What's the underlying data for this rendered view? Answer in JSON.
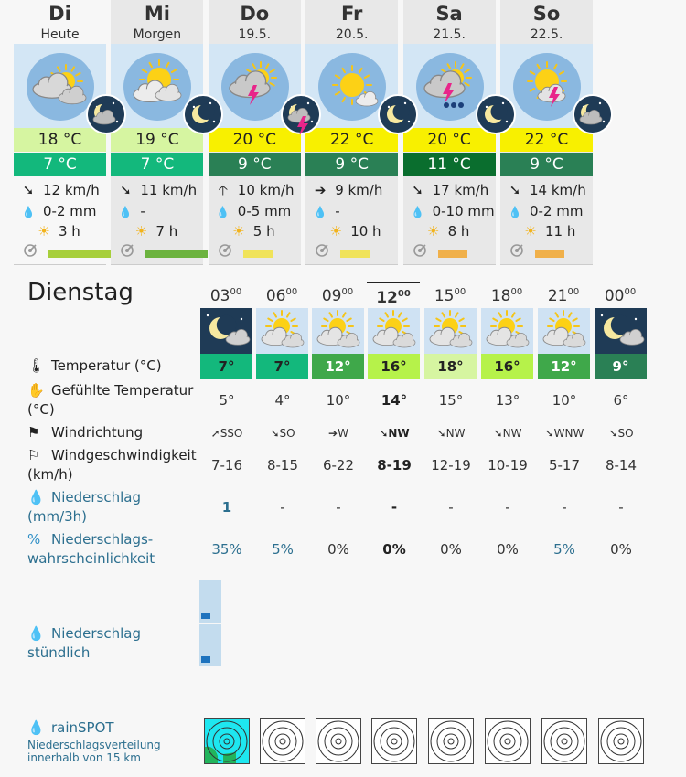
{
  "days": [
    {
      "name": "Di",
      "sub": "Heute",
      "tmax": "18 °C",
      "tmin": "7 °C",
      "wind": "12 km/h",
      "prec": "0-2 mm",
      "sun": "3 h",
      "tmax_color": "#d6f5a1",
      "tmin_color": "#13b87c",
      "uv_color": "#a7cf3b",
      "wind_arrow": "➘",
      "day_icon": "partly-cloudy-icon",
      "night_icon": "night-cloudy-icon"
    },
    {
      "name": "Mi",
      "sub": "Morgen",
      "tmax": "19 °C",
      "tmin": "7 °C",
      "wind": "11 km/h",
      "prec": "-",
      "sun": "7 h",
      "tmax_color": "#d6f5a1",
      "tmin_color": "#13b87c",
      "uv_color": "#6cb33f",
      "wind_arrow": "➘",
      "day_icon": "sun-cloud-icon",
      "night_icon": "night-clear-icon"
    },
    {
      "name": "Do",
      "sub": "19.5.",
      "tmax": "20 °C",
      "tmin": "9 °C",
      "wind": "10 km/h",
      "prec": "0-5 mm",
      "sun": "5 h",
      "tmax_color": "#f8f000",
      "tmin_color": "#2a8055",
      "uv_color": "#f0e35a",
      "wind_arrow": "🡡",
      "day_icon": "thunderstorm-icon",
      "night_icon": "night-thunder-icon"
    },
    {
      "name": "Fr",
      "sub": "20.5.",
      "tmax": "22 °C",
      "tmin": "9 °C",
      "wind": "9 km/h",
      "prec": "-",
      "sun": "10 h",
      "tmax_color": "#f8f000",
      "tmin_color": "#2a8055",
      "uv_color": "#f0e35a",
      "wind_arrow": "➔",
      "day_icon": "sunny-icon",
      "night_icon": "night-clear-icon"
    },
    {
      "name": "Sa",
      "sub": "21.5.",
      "tmax": "20 °C",
      "tmin": "11 °C",
      "wind": "17 km/h",
      "prec": "0-10 mm",
      "sun": "8 h",
      "tmax_color": "#f8f000",
      "tmin_color": "#0a6e2e",
      "uv_color": "#f0b04a",
      "wind_arrow": "➘",
      "day_icon": "thunder-rain-icon",
      "night_icon": "night-clear-icon"
    },
    {
      "name": "So",
      "sub": "22.5.",
      "tmax": "22 °C",
      "tmin": "9 °C",
      "wind": "14 km/h",
      "prec": "0-2 mm",
      "sun": "11 h",
      "tmax_color": "#f8f000",
      "tmin_color": "#2a8055",
      "uv_color": "#f0b04a",
      "wind_arrow": "➘",
      "day_icon": "sun-thunder-icon",
      "night_icon": "night-cloudy-icon"
    }
  ],
  "detail": {
    "title": "Dienstag",
    "hours": [
      {
        "h": "03",
        "m": "00",
        "temp": "7°",
        "feel": "5°",
        "dir": "SSO",
        "arrow": "➚",
        "speed": "7-16",
        "prec": "1",
        "prob": "35%",
        "bg": "#13b87c",
        "text": "#222",
        "night": true,
        "active": false
      },
      {
        "h": "06",
        "m": "00",
        "temp": "7°",
        "feel": "4°",
        "dir": "SO",
        "arrow": "➘",
        "speed": "8-15",
        "prec": "-",
        "prob": "5%",
        "bg": "#13b87c",
        "text": "#222",
        "night": false,
        "active": false
      },
      {
        "h": "09",
        "m": "00",
        "temp": "12°",
        "feel": "10°",
        "dir": "W",
        "arrow": "➔",
        "speed": "6-22",
        "prec": "-",
        "prob": "0%",
        "bg": "#3fa84a",
        "text": "#fff",
        "night": false,
        "active": false
      },
      {
        "h": "12",
        "m": "00",
        "temp": "16°",
        "feel": "14°",
        "dir": "NW",
        "arrow": "➘",
        "speed": "8-19",
        "prec": "-",
        "prob": "0%",
        "bg": "#b6f24a",
        "text": "#222",
        "night": false,
        "active": true
      },
      {
        "h": "15",
        "m": "00",
        "temp": "18°",
        "feel": "15°",
        "dir": "NW",
        "arrow": "➘",
        "speed": "12-19",
        "prec": "-",
        "prob": "0%",
        "bg": "#d6f5a1",
        "text": "#222",
        "night": false,
        "active": false
      },
      {
        "h": "18",
        "m": "00",
        "temp": "16°",
        "feel": "13°",
        "dir": "NW",
        "arrow": "➘",
        "speed": "10-19",
        "prec": "-",
        "prob": "0%",
        "bg": "#b6f24a",
        "text": "#222",
        "night": false,
        "active": false
      },
      {
        "h": "21",
        "m": "00",
        "temp": "12°",
        "feel": "10°",
        "dir": "WNW",
        "arrow": "➘",
        "speed": "5-17",
        "prec": "-",
        "prob": "5%",
        "bg": "#3fa84a",
        "text": "#fff",
        "night": false,
        "active": false
      },
      {
        "h": "00",
        "m": "00",
        "temp": "9°",
        "feel": "6°",
        "dir": "SO",
        "arrow": "➘",
        "speed": "8-14",
        "prec": "-",
        "prob": "0%",
        "bg": "#2a8055",
        "text": "#fff",
        "night": true,
        "active": false
      }
    ],
    "labels": {
      "temp": "Temperatur (°C)",
      "feel": "Gefühlte Temperatur (°C)",
      "dir": "Windrichtung",
      "speed": "Windgeschwindigkeit (km/h)",
      "prec": "Niederschlag (mm/3h)",
      "prob": "Niederschlags-wahrscheinlichkeit",
      "hourly": "Niederschlag stündlich",
      "rainspot": "rainSPOT",
      "rainspot_sub": "Niederschlagsverteilung innerhalb von 15 km"
    },
    "hourly_bars": [
      0.1,
      0.12
    ],
    "colors": {
      "label_blue": "#2c6f8f",
      "drop_blue": "#2f8fc6",
      "bar_blue": "#1e73be",
      "bar_bg": "#c3dcee"
    }
  }
}
